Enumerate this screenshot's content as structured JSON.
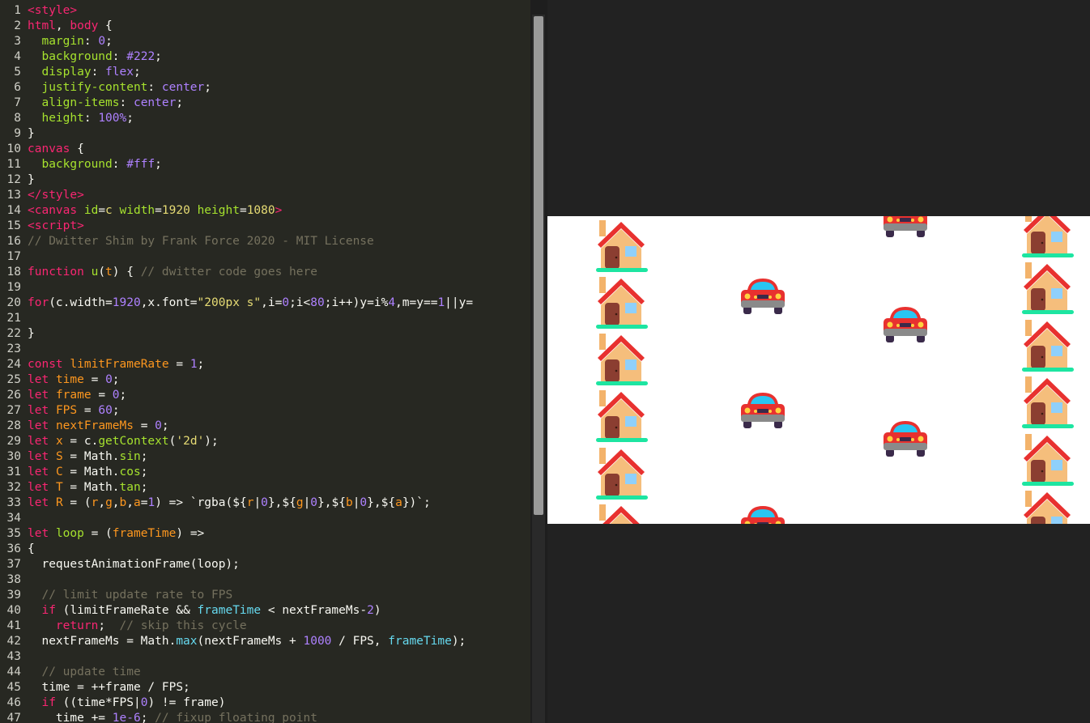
{
  "editor": {
    "lines": [
      {
        "n": "1",
        "html": "<span class='tg'>&lt;style&gt;</span>"
      },
      {
        "n": "2",
        "html": "<span class='tg'>html</span>, <span class='tg'>body</span> {"
      },
      {
        "n": "3",
        "html": "  <span class='pr'>margin</span>: <span class='nm'>0</span>;"
      },
      {
        "n": "4",
        "html": "  <span class='pr'>background</span>: <span class='nm'>#222</span>;"
      },
      {
        "n": "5",
        "html": "  <span class='pr'>display</span>: <span class='nm'>flex</span>;"
      },
      {
        "n": "6",
        "html": "  <span class='pr'>justify-content</span>: <span class='nm'>center</span>;"
      },
      {
        "n": "7",
        "html": "  <span class='pr'>align-items</span>: <span class='nm'>center</span>;"
      },
      {
        "n": "8",
        "html": "  <span class='pr'>height</span>: <span class='nm'>100%</span>;"
      },
      {
        "n": "9",
        "html": "}"
      },
      {
        "n": "10",
        "html": "<span class='tg'>canvas</span> {"
      },
      {
        "n": "11",
        "html": "  <span class='pr'>background</span>: <span class='nm'>#fff</span>;"
      },
      {
        "n": "12",
        "html": "}"
      },
      {
        "n": "13",
        "html": "<span class='tg'>&lt;/style&gt;</span>"
      },
      {
        "n": "14",
        "html": "<span class='tg'>&lt;canvas</span> <span class='pr'>id</span>=<span class='st'>c</span> <span class='pr'>width</span>=<span class='st'>1920</span> <span class='pr'>height</span>=<span class='st'>1080</span><span class='tg'>&gt;</span>"
      },
      {
        "n": "15",
        "html": "<span class='tg'>&lt;script&gt;</span>"
      },
      {
        "n": "16",
        "html": "<span class='cm'>// Dwitter Shim by Frank Force 2020 - MIT License</span>"
      },
      {
        "n": "17",
        "html": ""
      },
      {
        "n": "18",
        "html": "<span class='tg'>function</span> <span class='pr'>u</span>(<span class='pa'>t</span>) { <span class='cm'>// dwitter code goes here</span>"
      },
      {
        "n": "19",
        "html": ""
      },
      {
        "n": "20",
        "html": "<span class='tg'>for</span>(c.width=<span class='nm'>1920</span>,x.font=<span class='st'>\"200px s\"</span>,i=<span class='nm'>0</span>;i&lt;<span class='nm'>80</span>;i++)y=i%<span class='nm'>4</span>,m=y==<span class='nm'>1</span>||y="
      },
      {
        "n": "21",
        "html": ""
      },
      {
        "n": "22",
        "html": "}"
      },
      {
        "n": "23",
        "html": ""
      },
      {
        "n": "24",
        "html": "<span class='tg'>const</span> <span class='pa'>limitFrameRate</span> = <span class='nm'>1</span>;"
      },
      {
        "n": "25",
        "html": "<span class='tg'>let</span> <span class='pa'>time</span> = <span class='nm'>0</span>;"
      },
      {
        "n": "26",
        "html": "<span class='tg'>let</span> <span class='pa'>frame</span> = <span class='nm'>0</span>;"
      },
      {
        "n": "27",
        "html": "<span class='tg'>let</span> <span class='pa'>FPS</span> = <span class='nm'>60</span>;"
      },
      {
        "n": "28",
        "html": "<span class='tg'>let</span> <span class='pa'>nextFrameMs</span> = <span class='nm'>0</span>;"
      },
      {
        "n": "29",
        "html": "<span class='tg'>let</span> <span class='pa'>x</span> = c.<span class='pr'>getContext</span>(<span class='st'>'2d'</span>);"
      },
      {
        "n": "30",
        "html": "<span class='tg'>let</span> <span class='pa'>S</span> = Math.<span class='pr'>sin</span>;"
      },
      {
        "n": "31",
        "html": "<span class='tg'>let</span> <span class='pa'>C</span> = Math.<span class='pr'>cos</span>;"
      },
      {
        "n": "32",
        "html": "<span class='tg'>let</span> <span class='pa'>T</span> = Math.<span class='pr'>tan</span>;"
      },
      {
        "n": "33",
        "html": "<span class='tg'>let</span> <span class='pa'>R</span> = (<span class='pa'>r</span>,<span class='pa'>g</span>,<span class='pa'>b</span>,<span class='pa'>a</span>=<span class='nm'>1</span>) =&gt; `rgba(${<span class='pa'>r</span>|<span class='nm'>0</span>},${<span class='pa'>g</span>|<span class='nm'>0</span>},${<span class='pa'>b</span>|<span class='nm'>0</span>},${<span class='pa'>a</span>})`;"
      },
      {
        "n": "34",
        "html": ""
      },
      {
        "n": "35",
        "html": "<span class='tg'>let</span> <span class='pr'>loop</span> = (<span class='pa'>frameTime</span>) =&gt;"
      },
      {
        "n": "36",
        "html": "{"
      },
      {
        "n": "37",
        "html": "  requestAnimationFrame(loop);"
      },
      {
        "n": "38",
        "html": ""
      },
      {
        "n": "39",
        "html": "  <span class='cm'>// limit update rate to FPS</span>"
      },
      {
        "n": "40",
        "html": "  <span class='tg'>if</span> (limitFrameRate &amp;&amp; <span class='bl'>frameTime</span> &lt; nextFrameMs-<span class='nm'>2</span>)"
      },
      {
        "n": "41",
        "html": "    <span class='tg'>return</span>;  <span class='cm'>// skip this cycle</span>"
      },
      {
        "n": "42",
        "html": "  nextFrameMs = Math.<span class='bl'>max</span>(nextFrameMs + <span class='nm'>1000</span> / FPS, <span class='bl'>frameTime</span>);"
      },
      {
        "n": "43",
        "html": ""
      },
      {
        "n": "44",
        "html": "  <span class='cm'>// update time</span>"
      },
      {
        "n": "45",
        "html": "  time = ++frame / FPS;"
      },
      {
        "n": "46",
        "html": "  <span class='tg'>if</span> ((time*FPS|<span class='nm'>0</span>) != frame)"
      },
      {
        "n": "47",
        "html": "    time += <span class='nm'>1e-6</span>; <span class='cm'>// fixup floating point</span>"
      }
    ]
  },
  "preview": {
    "house_emoji": "house-with-garden",
    "car_emoji": "red-car",
    "houses_left_rows": 6,
    "houses_right_rows": 6
  }
}
